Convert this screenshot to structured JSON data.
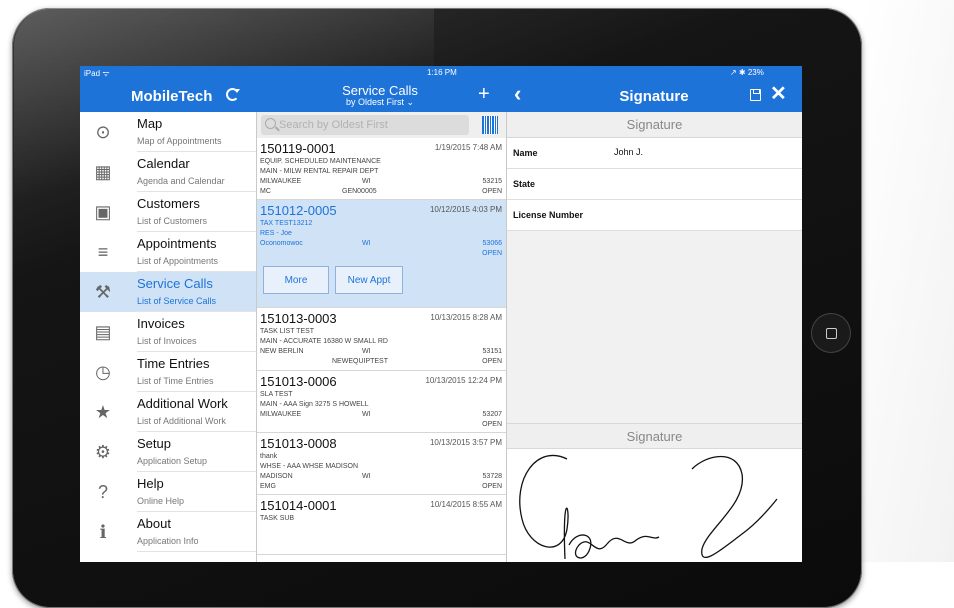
{
  "status": {
    "left": "iPad ᯤ",
    "time": "1:16 PM",
    "right": "↗ ✱ 23%"
  },
  "nav": {
    "app_title": "MobileTech",
    "list_title": "Service Calls",
    "list_subtitle": "by Oldest First ⌄",
    "detail_title": "Signature"
  },
  "sidebar": {
    "items": [
      {
        "title": "Map",
        "subtitle": "Map of Appointments",
        "icon": "map-pin-icon",
        "glyph": "⊙"
      },
      {
        "title": "Calendar",
        "subtitle": "Agenda and Calendar",
        "icon": "calendar-icon",
        "glyph": "▦"
      },
      {
        "title": "Customers",
        "subtitle": "List of Customers",
        "icon": "customers-icon",
        "glyph": "▣"
      },
      {
        "title": "Appointments",
        "subtitle": "List of Appointments",
        "icon": "appointments-icon",
        "glyph": "≡"
      },
      {
        "title": "Service Calls",
        "subtitle": "List of Service Calls",
        "icon": "service-calls-icon",
        "glyph": "⚒",
        "active": true
      },
      {
        "title": "Invoices",
        "subtitle": "List of Invoices",
        "icon": "invoice-icon",
        "glyph": "▤"
      },
      {
        "title": "Time Entries",
        "subtitle": "List of Time Entries",
        "icon": "time-entries-icon",
        "glyph": "◷"
      },
      {
        "title": "Additional Work",
        "subtitle": "List of Additional Work",
        "icon": "star-icon",
        "glyph": "★"
      },
      {
        "title": "Setup",
        "subtitle": "Application Setup",
        "icon": "gear-icon",
        "glyph": "⚙"
      },
      {
        "title": "Help",
        "subtitle": "Online Help",
        "icon": "help-icon",
        "glyph": "?"
      },
      {
        "title": "About",
        "subtitle": "Application Info",
        "icon": "info-icon",
        "glyph": "ℹ"
      }
    ]
  },
  "search": {
    "placeholder": "Search by Oldest First"
  },
  "calls": [
    {
      "number": "150119-0001",
      "datetime": "1/19/2015 7:48 AM",
      "line1": "EQUIP. SCHEDULED MAINTENANCE",
      "line2": "MAIN - MILW RENTAL REPAIR DEPT",
      "city": "MILWAUKEE",
      "state": "WI",
      "zip": "53215",
      "code": "MC",
      "type": "GEN00005",
      "status": "OPEN"
    },
    {
      "number": "151012-0005",
      "datetime": "10/12/2015 4:03 PM",
      "line1": "TAX TEST13212",
      "line2": "RES - Joe",
      "city": "Oconomowoc",
      "state": "WI",
      "zip": "53066",
      "status": "OPEN",
      "selected": true
    },
    {
      "number": "151013-0003",
      "datetime": "10/13/2015 8:28 AM",
      "line1": "TASK LIST TEST",
      "line2": "MAIN - ACCURATE 16380 W SMALL RD",
      "city": "NEW BERLIN",
      "state": "WI",
      "zip": "53151",
      "type": "NEWEQUIPTEST",
      "status": "OPEN"
    },
    {
      "number": "151013-0006",
      "datetime": "10/13/2015 12:24 PM",
      "line1": "SLA TEST",
      "line2": "MAIN - AAA Sign 3275 S HOWELL",
      "city": "MILWAUKEE",
      "state": "WI",
      "zip": "53207",
      "status": "OPEN"
    },
    {
      "number": "151013-0008",
      "datetime": "10/13/2015 3:57 PM",
      "line1": "thank",
      "line2": "WHSE - AAA WHSE MADISON",
      "city": "MADISON",
      "state": "WI",
      "zip": "53728",
      "code": "EMG",
      "status": "OPEN"
    },
    {
      "number": "151014-0001",
      "datetime": "10/14/2015 8:55 AM",
      "line1": "TASK SUB"
    }
  ],
  "call_actions": {
    "more": "More",
    "new_appt": "New Appt"
  },
  "detail": {
    "section1": "Signature",
    "fields": [
      {
        "label": "Name",
        "value": "John J."
      },
      {
        "label": "State",
        "value": ""
      },
      {
        "label": "License Number",
        "value": ""
      }
    ],
    "section2": "Signature"
  }
}
